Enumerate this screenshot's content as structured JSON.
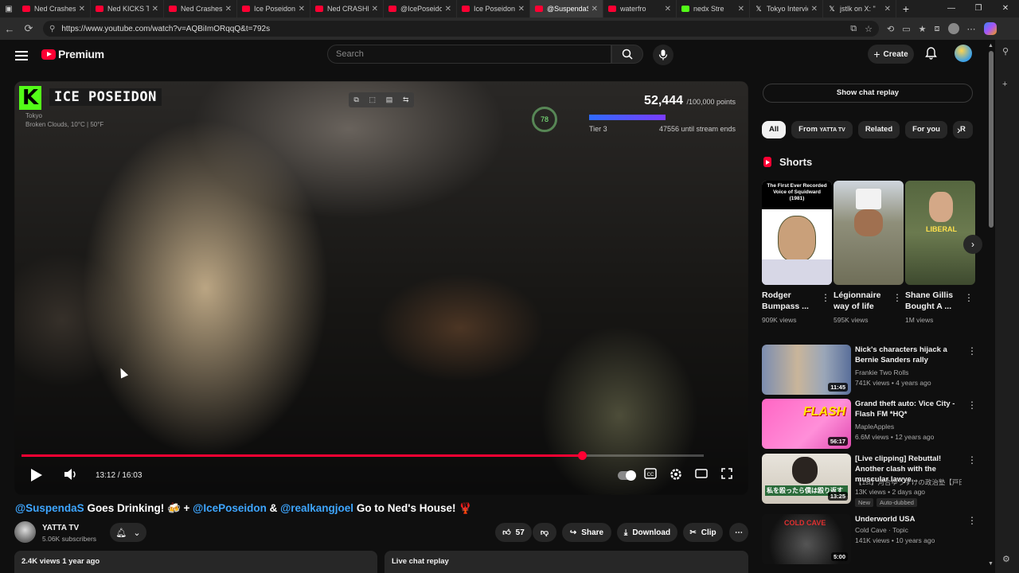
{
  "browser": {
    "tabs": [
      {
        "label": "Ned Crashes C",
        "fav": "yt"
      },
      {
        "label": "Ned KICKS Ta",
        "fav": "yt"
      },
      {
        "label": "Ned Crashes C",
        "fav": "yt"
      },
      {
        "label": "Ice Poseidon U",
        "fav": "yt"
      },
      {
        "label": "Ned CRASHES",
        "fav": "yt"
      },
      {
        "label": "@IcePoseidon",
        "fav": "yt"
      },
      {
        "label": "Ice Poseidon e",
        "fav": "yt"
      },
      {
        "label": "@SuspendaS",
        "fav": "yt",
        "active": true
      },
      {
        "label": "waterfro",
        "fav": "yt"
      },
      {
        "label": "nedx Stre",
        "fav": "kick"
      },
      {
        "label": "Tokyo Intervie",
        "fav": "x"
      },
      {
        "label": "jstlk on X: \"",
        "fav": "x"
      }
    ],
    "url": "https://www.youtube.com/watch?v=AQBiImORqqQ&t=792s"
  },
  "header": {
    "logo_text": "Premium",
    "search_placeholder": "Search",
    "create_label": "Create"
  },
  "player": {
    "overlay_title": "ICE POSEIDON",
    "overlay_logo": "K",
    "overlay_loc": "Tokyo",
    "overlay_weather": "Broken Clouds, 10°C | 50°F",
    "points": "52,444",
    "points_goal": "/100,000 points",
    "tier": "Tier 3",
    "until_end": "47556 until stream ends",
    "ring_value": "78",
    "time_current": "13:12",
    "time_total": "16:03",
    "time_display": "13:12 / 16:03",
    "progress": 0.822
  },
  "video": {
    "title_parts": [
      {
        "text": "@SuspendaS",
        "link": true
      },
      {
        "text": " Goes Drinking! 🍻 + ",
        "link": false
      },
      {
        "text": "@IcePoseidon",
        "link": true
      },
      {
        "text": " & ",
        "link": false
      },
      {
        "text": "@realkangjoel",
        "link": true
      },
      {
        "text": " Go to Ned's House! 🦞",
        "link": false
      }
    ],
    "channel": "YATTA TV",
    "subscribers": "5.06K subscribers",
    "likes": "57",
    "share": "Share",
    "download": "Download",
    "clip": "Clip",
    "views_date": "2.4K views  1 year ago",
    "live_chat": "Live chat replay"
  },
  "sidebar": {
    "chat_button": "Show chat replay",
    "chips": [
      {
        "label": "All",
        "active": true
      },
      {
        "label": "From",
        "sub": "YATTA TV"
      },
      {
        "label": "Related"
      },
      {
        "label": "For you"
      },
      {
        "label": "R"
      }
    ],
    "shorts_heading": "Shorts",
    "shorts": [
      {
        "title": "Rodger Bumpass ...",
        "views": "909K views",
        "caption": "The First Ever Recorded Voice of Squidward (1981)"
      },
      {
        "title": "Légionnaire way of life",
        "views": "595K views"
      },
      {
        "title": "Shane Gillis Bought A ...",
        "views": "1M views",
        "caption": "LIBERAL"
      }
    ],
    "recs": [
      {
        "title": "Nick's characters hijack a Bernie Sanders rally",
        "channel": "Frankie Two Rolls",
        "meta": "741K views • 4 years ago",
        "duration": "11:45"
      },
      {
        "title": "Grand theft auto: Vice City - Flash FM *HQ*",
        "channel": "MapleApples",
        "meta": "6.6M views • 12 years ago",
        "duration": "56:17",
        "thumb_text": "FLASH"
      },
      {
        "title": "[Live clipping] Rebuttal! Another clash with the muscular lawye...",
        "channel": "【1st】河合ゆうすけの政治塾【戸田市...",
        "meta": "13K views • 2 days ago",
        "duration": "13:25",
        "badges": [
          "New",
          "Auto-dubbed"
        ],
        "thumb_text": "私を殴ったら僕は殴り返す"
      },
      {
        "title": "Underworld USA",
        "channel": "Cold Cave · Topic",
        "meta": "141K views • 10 years ago",
        "duration": "5:00",
        "thumb_text": "COLD CAVE"
      }
    ]
  },
  "colors": {
    "accent": "#ff0033",
    "link": "#3ea6ff",
    "bg": "#0f0f0f",
    "kick": "#53fc18"
  }
}
